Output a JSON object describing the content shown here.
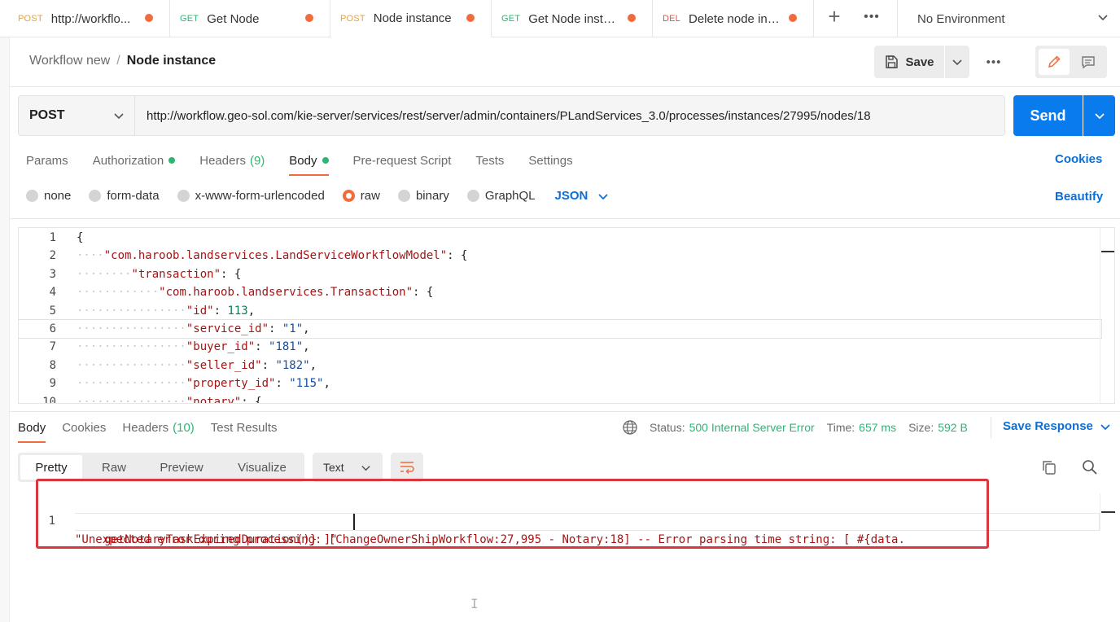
{
  "colors": {
    "accent_orange": "#f26b3a",
    "primary_blue": "#097bed",
    "link_blue": "#0b6fd6",
    "success_green": "#2bb673",
    "error_red": "#d9363e"
  },
  "tabs": [
    {
      "method": "POST",
      "name": "http://workflo...",
      "unsaved": true
    },
    {
      "method": "GET",
      "name": "Get Node",
      "unsaved": true
    },
    {
      "method": "POST",
      "name": "Node instance",
      "unsaved": true,
      "active": true
    },
    {
      "method": "GET",
      "name": "Get Node insta...",
      "unsaved": true
    },
    {
      "method": "DEL",
      "name": "Delete node ins...",
      "unsaved": true
    }
  ],
  "environment": {
    "selected": "No Environment"
  },
  "breadcrumb": {
    "parent": "Workflow new",
    "separator": "/",
    "current": "Node instance"
  },
  "toolbar": {
    "save_label": "Save"
  },
  "request": {
    "method": "POST",
    "url": "http://workflow.geo-sol.com/kie-server/services/rest/server/admin/containers/PLandServices_3.0/processes/instances/27995/nodes/18",
    "send_label": "Send"
  },
  "request_tabs": {
    "params": "Params",
    "authorization": "Authorization",
    "headers": "Headers",
    "headers_count": "(9)",
    "body": "Body",
    "prerequest": "Pre-request Script",
    "tests": "Tests",
    "settings": "Settings",
    "cookies": "Cookies"
  },
  "body_types": {
    "none": "none",
    "form_data": "form-data",
    "urlencoded": "x-www-form-urlencoded",
    "raw": "raw",
    "binary": "binary",
    "graphql": "GraphQL",
    "language": "JSON",
    "beautify": "Beautify"
  },
  "editor": {
    "lines": [
      {
        "n": "1",
        "indent": "",
        "key": "",
        "after": "{"
      },
      {
        "n": "2",
        "indent": "····",
        "key": "\"com.haroob.landservices.LandServiceWorkflowModel\"",
        "after": ": {"
      },
      {
        "n": "3",
        "indent": "········",
        "key": "\"transaction\"",
        "after": ": {"
      },
      {
        "n": "4",
        "indent": "············",
        "key": "\"com.haroob.landservices.Transaction\"",
        "after": ": {"
      },
      {
        "n": "5",
        "indent": "················",
        "key": "\"id\"",
        "after": ": ",
        "value": "113",
        "vtype": "n",
        "tail": ","
      },
      {
        "n": "6",
        "indent": "················",
        "key": "\"service_id\"",
        "after": ": ",
        "value": "\"1\"",
        "vtype": "s",
        "tail": ","
      },
      {
        "n": "7",
        "indent": "················",
        "key": "\"buyer_id\"",
        "after": ": ",
        "value": "\"181\"",
        "vtype": "s",
        "tail": ","
      },
      {
        "n": "8",
        "indent": "················",
        "key": "\"seller_id\"",
        "after": ": ",
        "value": "\"182\"",
        "vtype": "s",
        "tail": ","
      },
      {
        "n": "9",
        "indent": "················",
        "key": "\"property_id\"",
        "after": ": ",
        "value": "\"115\"",
        "vtype": "s",
        "tail": ","
      },
      {
        "n": "10",
        "indent": "················",
        "key": "\"notary\"",
        "after": ": {"
      }
    ]
  },
  "response_tabs": {
    "body": "Body",
    "cookies": "Cookies",
    "headers": "Headers",
    "headers_count": "(10)",
    "test_results": "Test Results"
  },
  "response_meta": {
    "status_label": "Status:",
    "status": "500 Internal Server Error",
    "time_label": "Time:",
    "time": "657 ms",
    "size_label": "Size:",
    "size": "592 B",
    "save_response": "Save Response"
  },
  "view_tabs": {
    "pretty": "Pretty",
    "raw": "Raw",
    "preview": "Preview",
    "visualize": "Visualize",
    "format": "Text"
  },
  "response_body": {
    "line_number": "1",
    "line1": "\"Unexpected error during processing: [ChangeOwnerShipWorkflow:27,995 - Notary:18] -- Error parsing time string: [ #{data.",
    "line2": "getNotaryTaskExpiredDuration()} ]\""
  }
}
